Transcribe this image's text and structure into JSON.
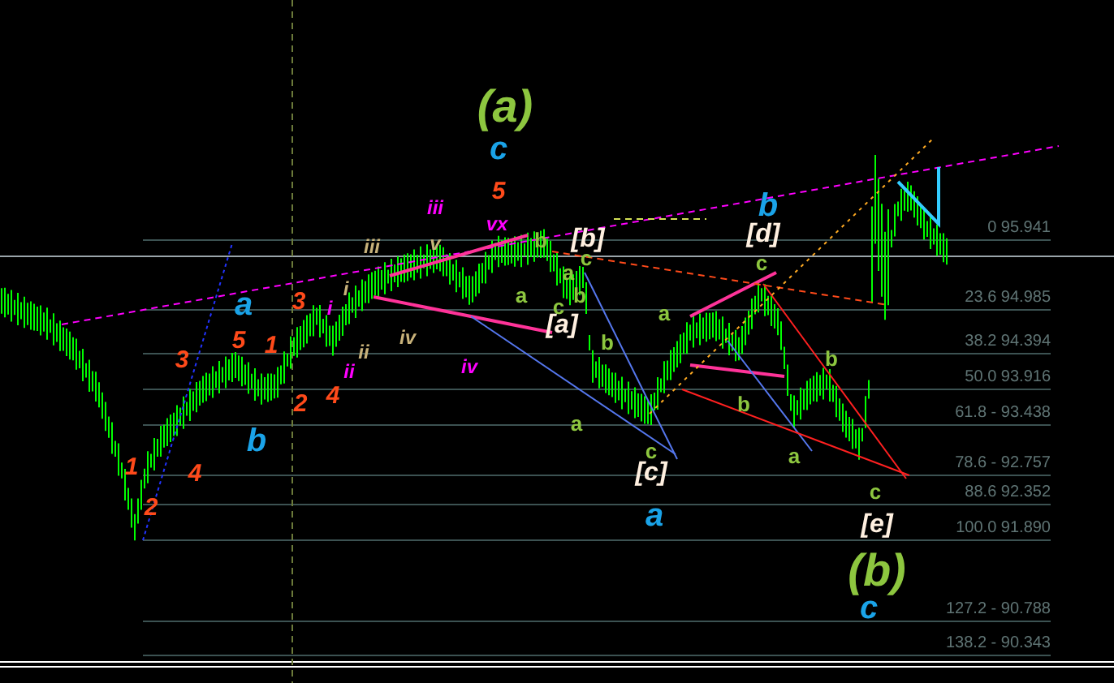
{
  "chart": {
    "fib_levels": [
      {
        "label": "0 95.941"
      },
      {
        "label": "23.6 94.985"
      },
      {
        "label": "38.2 94.394"
      },
      {
        "label": "50.0 93.916"
      },
      {
        "label": "61.8 - 93.438"
      },
      {
        "label": "78.6 - 92.757"
      },
      {
        "label": "88.6 92.352"
      },
      {
        "label": "100.0 91.890"
      },
      {
        "label": "127.2 - 90.788"
      },
      {
        "label": "138.2 - 90.343"
      }
    ],
    "wave_labels": [
      {
        "text": "(a)",
        "kind": "large",
        "color": "#8dc63f"
      },
      {
        "text": "c",
        "kind": "medium",
        "color": "#1aa3e8"
      },
      {
        "text": "5",
        "kind": "number",
        "color": "#ff4a1a"
      },
      {
        "text": "vx",
        "kind": "roman",
        "color": "#ff00ff"
      },
      {
        "text": "iii",
        "kind": "roman",
        "color": "#ff00ff"
      },
      {
        "text": "iii",
        "kind": "roman",
        "color": "#c8b27a"
      },
      {
        "text": "v",
        "kind": "roman",
        "color": "#c8b27a"
      },
      {
        "text": "b",
        "kind": "small",
        "color": "#8dc63f"
      },
      {
        "text": "[b]",
        "kind": "bracket",
        "color": "#fff0e0"
      },
      {
        "text": "c",
        "kind": "small",
        "color": "#8dc63f"
      },
      {
        "text": "a",
        "kind": "small",
        "color": "#8dc63f"
      },
      {
        "text": "b",
        "kind": "medium",
        "color": "#1aa3e8"
      },
      {
        "text": "[d]",
        "kind": "bracket",
        "color": "#fff0e0"
      },
      {
        "text": "c",
        "kind": "small",
        "color": "#8dc63f"
      },
      {
        "text": "i",
        "kind": "roman",
        "color": "#c8b27a"
      },
      {
        "text": "a",
        "kind": "medium",
        "color": "#1aa3e8"
      },
      {
        "text": "3",
        "kind": "number",
        "color": "#ff4a1a"
      },
      {
        "text": "i",
        "kind": "roman",
        "color": "#ff00ff"
      },
      {
        "text": "a",
        "kind": "small",
        "color": "#8dc63f"
      },
      {
        "text": "b",
        "kind": "small",
        "color": "#8dc63f"
      },
      {
        "text": "c",
        "kind": "small",
        "color": "#8dc63f"
      },
      {
        "text": "[a]",
        "kind": "bracket",
        "color": "#fff0e0"
      },
      {
        "text": "a",
        "kind": "small",
        "color": "#8dc63f"
      },
      {
        "text": "5",
        "kind": "number",
        "color": "#ff4a1a"
      },
      {
        "text": "iv",
        "kind": "roman",
        "color": "#c8b27a"
      },
      {
        "text": "1",
        "kind": "number",
        "color": "#ff4a1a"
      },
      {
        "text": "b",
        "kind": "small",
        "color": "#8dc63f"
      },
      {
        "text": "3",
        "kind": "number",
        "color": "#ff4a1a"
      },
      {
        "text": "ii",
        "kind": "roman",
        "color": "#c8b27a"
      },
      {
        "text": "b",
        "kind": "small",
        "color": "#8dc63f"
      },
      {
        "text": "ii",
        "kind": "roman",
        "color": "#ff00ff"
      },
      {
        "text": "iv",
        "kind": "roman",
        "color": "#ff00ff"
      },
      {
        "text": "4",
        "kind": "number",
        "color": "#ff4a1a"
      },
      {
        "text": "2",
        "kind": "number",
        "color": "#ff4a1a"
      },
      {
        "text": "b",
        "kind": "small",
        "color": "#8dc63f"
      },
      {
        "text": "a",
        "kind": "small",
        "color": "#8dc63f"
      },
      {
        "text": "b",
        "kind": "medium",
        "color": "#1aa3e8"
      },
      {
        "text": "c",
        "kind": "small",
        "color": "#8dc63f"
      },
      {
        "text": "a",
        "kind": "small",
        "color": "#8dc63f"
      },
      {
        "text": "1",
        "kind": "number",
        "color": "#ff4a1a"
      },
      {
        "text": "4",
        "kind": "number",
        "color": "#ff4a1a"
      },
      {
        "text": "[c]",
        "kind": "bracket",
        "color": "#fff0e0"
      },
      {
        "text": "c",
        "kind": "small",
        "color": "#8dc63f"
      },
      {
        "text": "2",
        "kind": "number",
        "color": "#ff4a1a"
      },
      {
        "text": "a",
        "kind": "medium",
        "color": "#1aa3e8"
      },
      {
        "text": "[e]",
        "kind": "bracket",
        "color": "#fff0e0"
      },
      {
        "text": "(b)",
        "kind": "large",
        "color": "#8dc63f"
      },
      {
        "text": "c",
        "kind": "medium",
        "color": "#1aa3e8"
      }
    ]
  }
}
